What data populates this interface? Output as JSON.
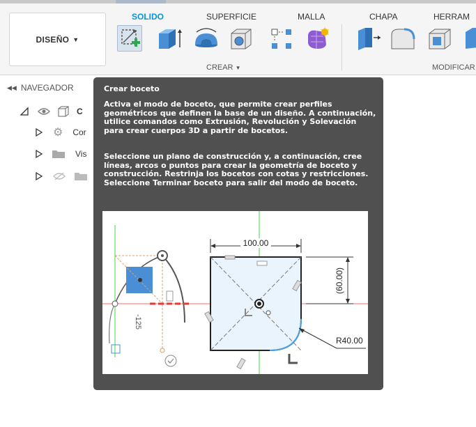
{
  "toolbar": {
    "design_button": "DISEÑO",
    "tabs": [
      "SOLIDO",
      "SUPERFICIE",
      "MALLA",
      "CHAPA",
      "HERRAM"
    ],
    "groups": {
      "create": "CREAR",
      "modify": "MODIFICAR"
    },
    "tools": [
      "create-sketch-icon",
      "extrude-icon",
      "revolve-icon",
      "sweep-icon",
      "hole-icon",
      "pattern-icon",
      "form-icon",
      "press-pull-icon",
      "fillet-icon",
      "shell-icon",
      "combine-icon"
    ]
  },
  "navigator": {
    "title": "NAVEGADOR",
    "items": [
      {
        "label": "C"
      },
      {
        "label": "Cor"
      },
      {
        "label": "Vis"
      },
      {
        "label": ""
      }
    ]
  },
  "tooltip": {
    "title": "Crear boceto",
    "paragraph1": "Activa el modo de boceto, que permite crear perfiles geométricos que definen la base de un diseño. A continuación, utilice comandos como Extrusión, Revolución y Solevación para crear cuerpos 3D a partir de bocetos.",
    "paragraph2": "Seleccione un plano de construcción y, a continuación, cree líneas, arcos o puntos para crear la geometría de boceto y construcción. Restrinja los bocetos con cotas y restricciones. Seleccione Terminar boceto para salir del modo de boceto.",
    "illustration": {
      "dim_width": "100.00",
      "dim_height": "(60.00)",
      "dim_radius": "R40.00",
      "dim_left": "-125"
    }
  },
  "colors": {
    "accent": "#0696d7",
    "tooltip_bg": "#505050"
  }
}
